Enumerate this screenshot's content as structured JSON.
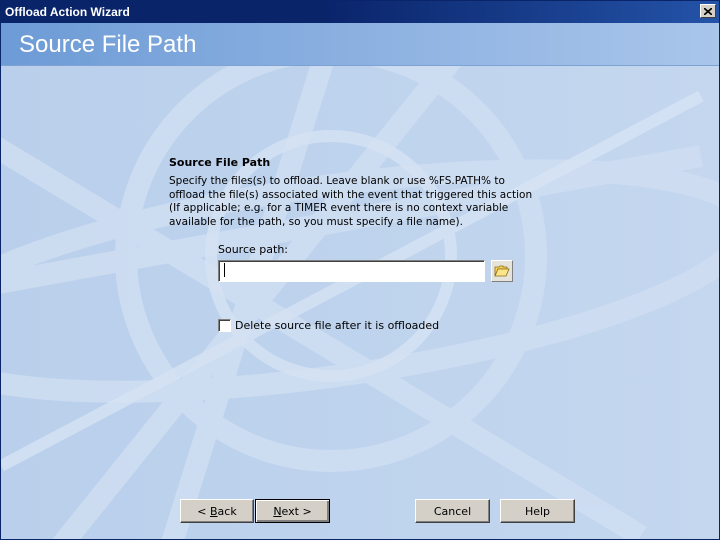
{
  "window": {
    "title": "Offload Action Wizard"
  },
  "header": {
    "heading": "Source File Path"
  },
  "section": {
    "title": "Source File Path",
    "description_lines": [
      "Specify the files(s) to offload. Leave blank or use %FS.PATH% to",
      "offload the file(s) associated with the event that triggered this action",
      "(If applicable; e.g. for a TIMER event there is no context variable",
      "available for the path, so you must specify a file name)."
    ]
  },
  "source_path": {
    "label": "Source path:",
    "value": ""
  },
  "delete_option": {
    "label": "Delete source file after it is offloaded",
    "checked": false
  },
  "buttons": {
    "back_prefix": "< ",
    "back_accel": "B",
    "back_rest": "ack",
    "next_accel": "N",
    "next_rest": "ext >",
    "cancel": "Cancel",
    "help": "Help"
  },
  "colors": {
    "titlebar": "#0a246a",
    "header_band": "#7ea6dc",
    "body_background": "#bcd1ec"
  }
}
